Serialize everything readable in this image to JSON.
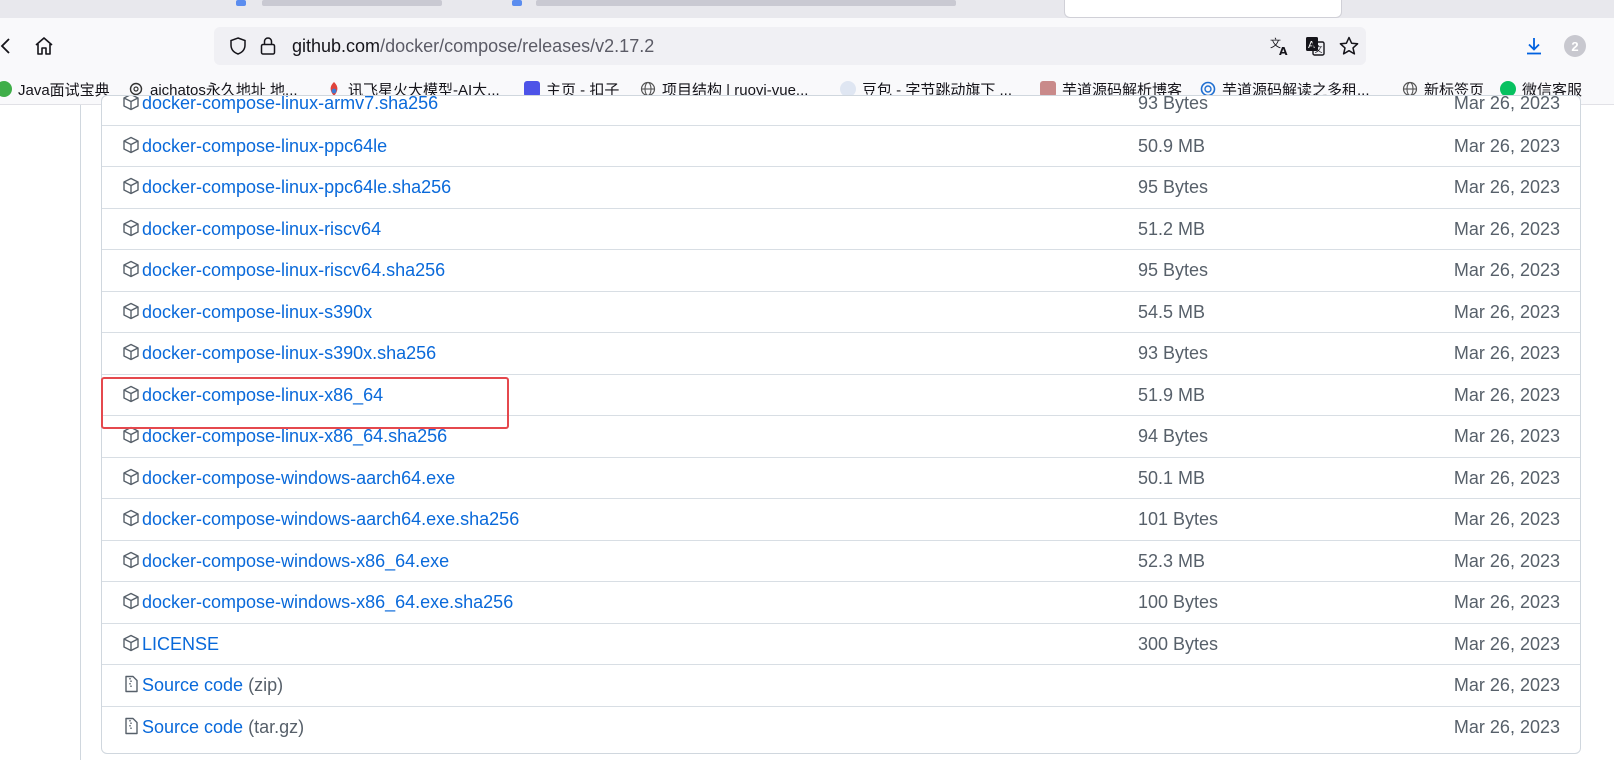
{
  "browser": {
    "url_host": "github.com",
    "url_path": "/docker/compose/releases/v2.17.2",
    "extension_badge": "2",
    "icons": {
      "back": "back-arrow-icon",
      "home": "home-icon",
      "shield": "tracking-shield-icon",
      "lock": "lock-icon",
      "translate": "translate-icon",
      "page_translate": "page-translate-icon",
      "bookmark_star": "star-icon",
      "downloads": "download-icon"
    }
  },
  "bookmarks": [
    {
      "label": "Java面试宝典",
      "icon": "frog-icon",
      "color": "#3fae49"
    },
    {
      "label": "aichatos永久地址 地...",
      "icon": "openai-icon",
      "color": "#333333"
    },
    {
      "label": "讯飞星火大模型-AI大...",
      "icon": "spark-icon",
      "color": "#e0433b"
    },
    {
      "label": "主页 - 扣子",
      "icon": "coze-icon",
      "color": "#4d53e8"
    },
    {
      "label": "项目结构 | ruoyi-vue...",
      "icon": "globe-icon",
      "color": "#555555"
    },
    {
      "label": "豆包 - 字节跳动旗下 ...",
      "icon": "doubao-icon",
      "color": "#7a8fb5"
    },
    {
      "label": "芋道源码解析博客",
      "icon": "avatar-icon",
      "color": "#c98a8a"
    },
    {
      "label": "芋道源码解读之多租...",
      "icon": "iconfont-icon",
      "color": "#1f6fd1"
    },
    {
      "label": "新标签页",
      "icon": "globe-icon",
      "color": "#555555"
    },
    {
      "label": "微信客服",
      "icon": "wechat-icon",
      "color": "#07c160"
    }
  ],
  "assets": [
    {
      "name": "docker-compose-linux-armv7.sha256",
      "suffix": "",
      "size": "93 Bytes",
      "date": "Mar 26, 2023",
      "icon": "package-icon"
    },
    {
      "name": "docker-compose-linux-ppc64le",
      "suffix": "",
      "size": "50.9 MB",
      "date": "Mar 26, 2023",
      "icon": "package-icon"
    },
    {
      "name": "docker-compose-linux-ppc64le.sha256",
      "suffix": "",
      "size": "95 Bytes",
      "date": "Mar 26, 2023",
      "icon": "package-icon"
    },
    {
      "name": "docker-compose-linux-riscv64",
      "suffix": "",
      "size": "51.2 MB",
      "date": "Mar 26, 2023",
      "icon": "package-icon"
    },
    {
      "name": "docker-compose-linux-riscv64.sha256",
      "suffix": "",
      "size": "95 Bytes",
      "date": "Mar 26, 2023",
      "icon": "package-icon"
    },
    {
      "name": "docker-compose-linux-s390x",
      "suffix": "",
      "size": "54.5 MB",
      "date": "Mar 26, 2023",
      "icon": "package-icon"
    },
    {
      "name": "docker-compose-linux-s390x.sha256",
      "suffix": "",
      "size": "93 Bytes",
      "date": "Mar 26, 2023",
      "icon": "package-icon"
    },
    {
      "name": "docker-compose-linux-x86_64",
      "suffix": "",
      "size": "51.9 MB",
      "date": "Mar 26, 2023",
      "icon": "package-icon",
      "highlighted": true
    },
    {
      "name": "docker-compose-linux-x86_64.sha256",
      "suffix": "",
      "size": "94 Bytes",
      "date": "Mar 26, 2023",
      "icon": "package-icon"
    },
    {
      "name": "docker-compose-windows-aarch64.exe",
      "suffix": "",
      "size": "50.1 MB",
      "date": "Mar 26, 2023",
      "icon": "package-icon"
    },
    {
      "name": "docker-compose-windows-aarch64.exe.sha256",
      "suffix": "",
      "size": "101 Bytes",
      "date": "Mar 26, 2023",
      "icon": "package-icon"
    },
    {
      "name": "docker-compose-windows-x86_64.exe",
      "suffix": "",
      "size": "52.3 MB",
      "date": "Mar 26, 2023",
      "icon": "package-icon"
    },
    {
      "name": "docker-compose-windows-x86_64.exe.sha256",
      "suffix": "",
      "size": "100 Bytes",
      "date": "Mar 26, 2023",
      "icon": "package-icon"
    },
    {
      "name": "LICENSE",
      "suffix": "",
      "size": "300 Bytes",
      "date": "Mar 26, 2023",
      "icon": "package-icon"
    },
    {
      "name": "Source code",
      "suffix": "(zip)",
      "size": "",
      "date": "Mar 26, 2023",
      "icon": "file-zip-icon"
    },
    {
      "name": "Source code",
      "suffix": "(tar.gz)",
      "size": "",
      "date": "Mar 26, 2023",
      "icon": "file-zip-icon"
    }
  ],
  "colors": {
    "link": "#0969da",
    "muted": "#57606a",
    "highlight": "#e5484d",
    "download_blue": "#0061e0"
  }
}
